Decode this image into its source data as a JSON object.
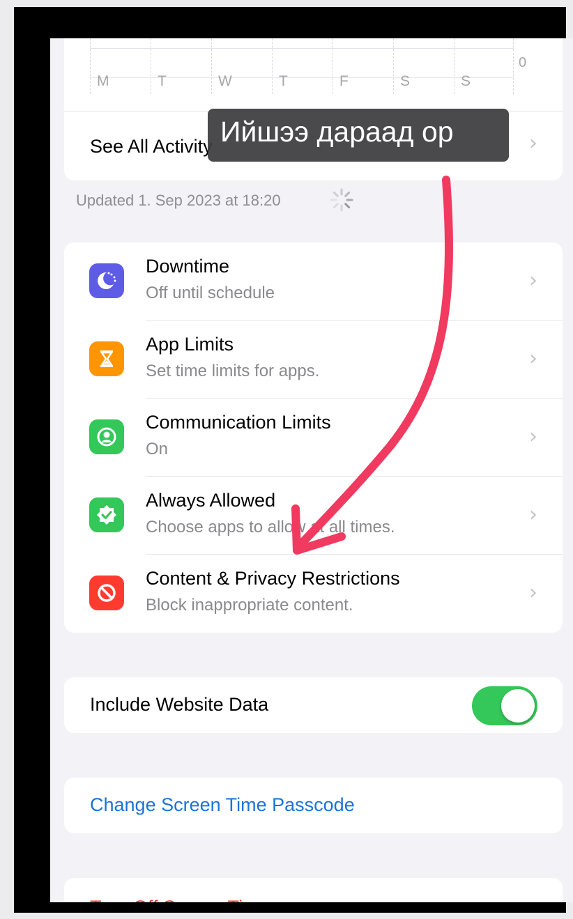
{
  "chart": {
    "day_labels": [
      "M",
      "T",
      "W",
      "T",
      "F",
      "S",
      "S"
    ],
    "axis_zero": "0"
  },
  "activity": {
    "see_all_label": "See All Activity",
    "updated_text": "Updated 1. Sep 2023 at 18:20"
  },
  "settings": {
    "items": [
      {
        "title": "Downtime",
        "subtitle": "Off until schedule",
        "icon": "moon-clock-icon",
        "color": "#5e5ce6"
      },
      {
        "title": "App Limits",
        "subtitle": "Set time limits for apps.",
        "icon": "hourglass-icon",
        "color": "#ff9500"
      },
      {
        "title": "Communication Limits",
        "subtitle": "On",
        "icon": "person-circle-icon",
        "color": "#34c759"
      },
      {
        "title": "Always Allowed",
        "subtitle": "Choose apps to allow at all times.",
        "icon": "checkmark-badge-icon",
        "color": "#34c759"
      },
      {
        "title": "Content & Privacy Restrictions",
        "subtitle": "Block inappropriate content.",
        "icon": "restriction-icon",
        "color": "#ff3b30"
      }
    ]
  },
  "website_data": {
    "label": "Include Website Data",
    "enabled": true,
    "toggle_color": "#34c759"
  },
  "passcode": {
    "label": "Change Screen Time Passcode"
  },
  "turn_off": {
    "label": "Turn Off Screen Time"
  },
  "annotation": {
    "tooltip_text": "Ийшээ дараад ор",
    "arrow_color": "#f03a5f"
  }
}
